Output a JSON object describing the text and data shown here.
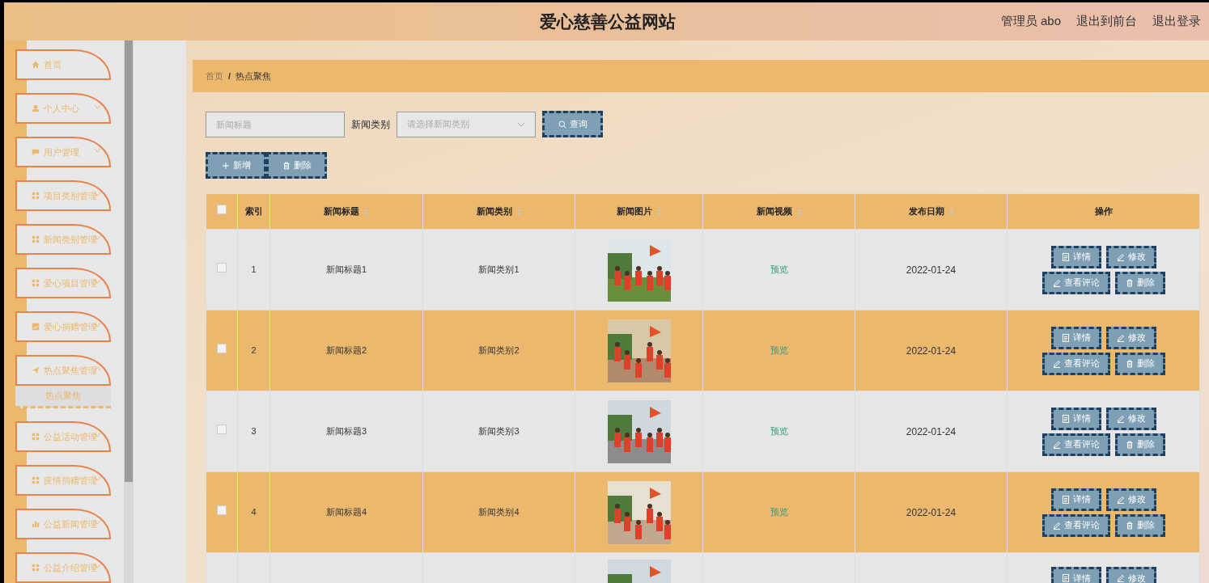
{
  "header": {
    "title": "爱心慈善公益网站",
    "user": "管理员 abo",
    "links": [
      "退出到前台",
      "退出登录"
    ]
  },
  "sidebar": {
    "items": [
      {
        "label": "首页",
        "kind": "home"
      },
      {
        "label": "个人中心",
        "kind": "user",
        "expanded": false
      },
      {
        "label": "用户管理",
        "kind": "chat",
        "expanded": false
      },
      {
        "label": "项目类别管理",
        "kind": "grid",
        "expanded": false
      },
      {
        "label": "新闻类别管理",
        "kind": "grid",
        "expanded": false
      },
      {
        "label": "爱心项目管理",
        "kind": "grid",
        "expanded": false
      },
      {
        "label": "爱心捐赠管理",
        "kind": "chart",
        "expanded": false
      },
      {
        "label": "热点聚焦管理",
        "kind": "send",
        "expanded": true,
        "children": [
          {
            "label": "热点聚焦",
            "selected": true
          }
        ]
      },
      {
        "label": "公益活动管理",
        "kind": "grid",
        "expanded": false
      },
      {
        "label": "疫情捐赠管理",
        "kind": "grid",
        "expanded": false
      },
      {
        "label": "公益新闻管理",
        "kind": "bars",
        "expanded": false
      },
      {
        "label": "公益介绍管理",
        "kind": "grid",
        "expanded": false
      }
    ]
  },
  "breadcrumb": [
    "首页",
    "/",
    "热点聚焦"
  ],
  "search": {
    "title_placeholder": "新闻标题",
    "category_label": "新闻类别",
    "category_placeholder": "请选择新闻类别",
    "query_button": "查询"
  },
  "toolbar": [
    "新增",
    "删除"
  ],
  "table": {
    "columns": [
      "索引",
      "新闻标题",
      "新闻类别",
      "新闻图片",
      "新闻视频",
      "发布日期",
      "操作"
    ],
    "header_checked": false,
    "rows": [
      {
        "index": "1",
        "title": "新闻标题1",
        "category": "新闻类别1",
        "picture": {
          "kind": "picture"
        },
        "video": "预览",
        "date": "2022-01-24",
        "selected": false,
        "actions": [
          "详情",
          "修改",
          "查看评论",
          "删除"
        ]
      },
      {
        "index": "2",
        "title": "新闻标题2",
        "category": "新闻类别2",
        "picture": {
          "kind": "picture"
        },
        "video": "预览",
        "date": "2022-01-24",
        "selected": false,
        "actions": [
          "详情",
          "修改",
          "查看评论",
          "删除"
        ]
      },
      {
        "index": "3",
        "title": "新闻标题3",
        "category": "新闻类别3",
        "picture": {
          "kind": "picture"
        },
        "video": "预览",
        "date": "2022-01-24",
        "selected": false,
        "actions": [
          "详情",
          "修改",
          "查看评论",
          "删除"
        ]
      },
      {
        "index": "4",
        "title": "新闻标题4",
        "category": "新闻类别4",
        "picture": {
          "kind": "picture"
        },
        "video": "预览",
        "date": "2022-01-24",
        "selected": false,
        "actions": [
          "详情",
          "修改",
          "查看评论",
          "删除"
        ]
      },
      {
        "picture": {
          "kind": "picture"
        },
        "actions": [
          "详情",
          "修改"
        ]
      }
    ]
  }
}
